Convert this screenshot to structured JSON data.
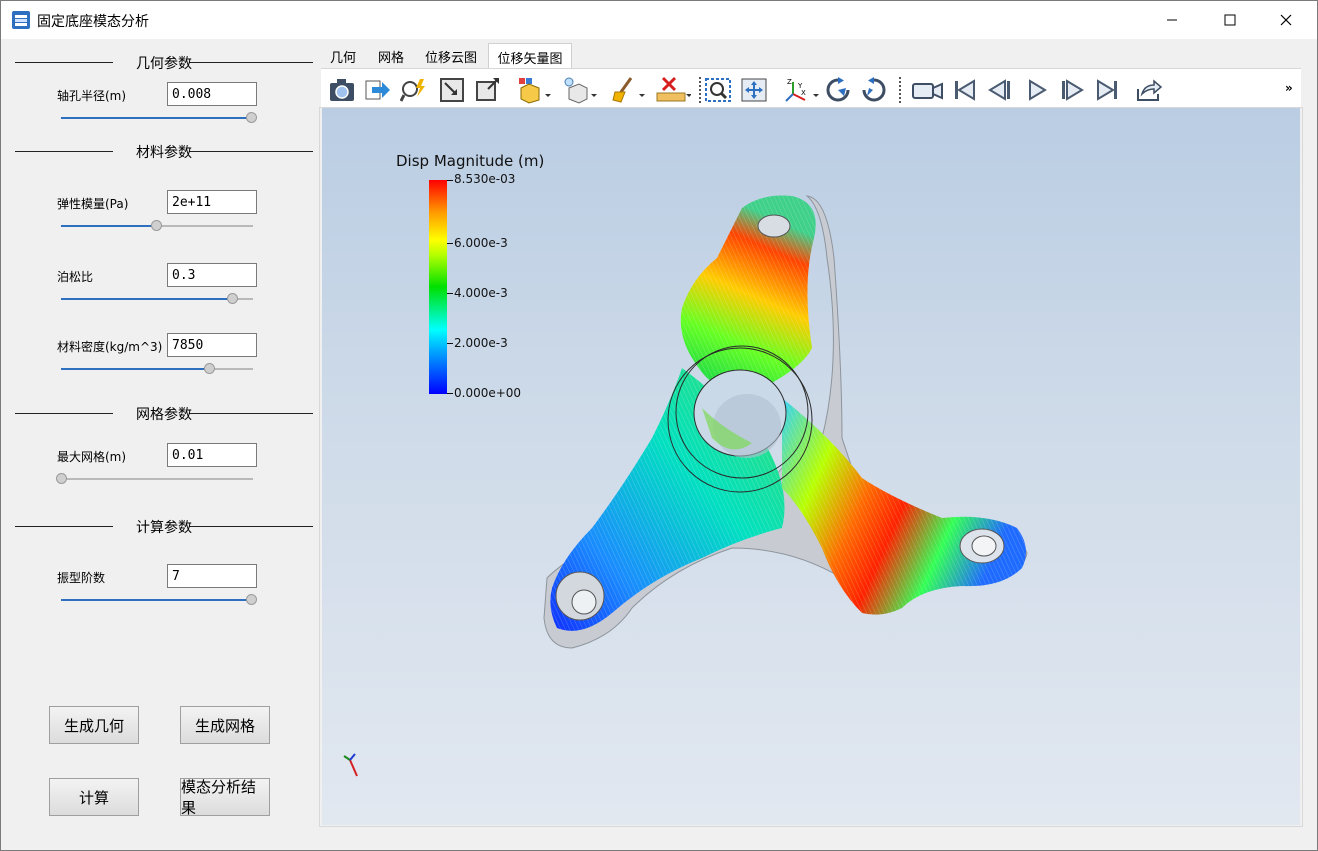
{
  "window": {
    "title": "固定底座模态分析"
  },
  "left_panel": {
    "sections": {
      "geometry": "几何参数",
      "material": "材料参数",
      "mesh": "网格参数",
      "compute": "计算参数"
    },
    "params": {
      "hole_radius": {
        "label": "轴孔半径(m)",
        "value": "0.008",
        "slider": 1.0
      },
      "youngs": {
        "label": "弹性模量(Pa)",
        "value": "2e+11",
        "slider": 0.5
      },
      "poisson": {
        "label": "泊松比",
        "value": "0.3",
        "slider": 0.9
      },
      "density": {
        "label": "材料密度(kg/m^3)",
        "value": "7850",
        "slider": 0.78
      },
      "max_mesh": {
        "label": "最大网格(m)",
        "value": "0.01",
        "slider": 0.0
      },
      "modes": {
        "label": "振型阶数",
        "value": "7",
        "slider": 1.0
      }
    },
    "buttons": {
      "gen_geometry": "生成几何",
      "gen_mesh": "生成网格",
      "compute": "计算",
      "modal_results": "模态分析结果"
    }
  },
  "tabs": [
    "几何",
    "网格",
    "位移云图",
    "位移矢量图"
  ],
  "active_tab": 3,
  "toolbar": {
    "more": "»"
  },
  "viewport": {
    "legend_title": "Disp Magnitude (m)",
    "legend_labels": [
      "8.530e-03",
      "6.000e-3",
      "4.000e-3",
      "2.000e-3",
      "0.000e+00"
    ],
    "axes_labels": {
      "z": "Z",
      "y": "Y",
      "x": "X"
    }
  }
}
